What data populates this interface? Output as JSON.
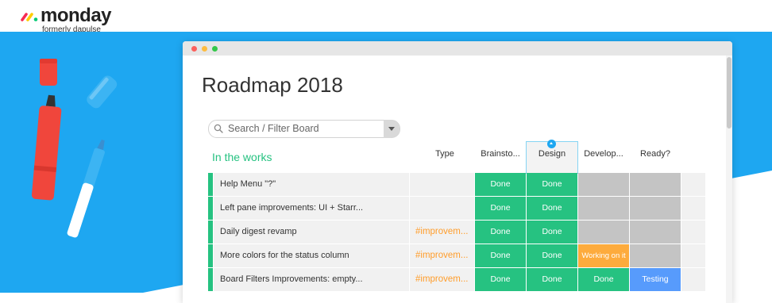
{
  "brand": {
    "name": "monday",
    "subtitle": "formerly dapulse"
  },
  "board": {
    "title": "Roadmap 2018",
    "search": {
      "placeholder": "Search / Filter Board",
      "value": ""
    },
    "group": {
      "title": "In the works",
      "color": "#26c281"
    },
    "columns": [
      "Type",
      "Brainsto...",
      "Design",
      "Develop...",
      "Ready?"
    ],
    "selected_column": "Design",
    "rows": [
      {
        "name": "Help Menu \"?\"",
        "type": "",
        "brainstorm": "Done",
        "design": "Done",
        "develop": "",
        "ready": ""
      },
      {
        "name": "Left pane improvements: UI + Starr...",
        "type": "",
        "brainstorm": "Done",
        "design": "Done",
        "develop": "",
        "ready": ""
      },
      {
        "name": "Daily digest revamp",
        "type": "#improvem...",
        "brainstorm": "Done",
        "design": "Done",
        "develop": "",
        "ready": ""
      },
      {
        "name": "More colors for the status column",
        "type": "#improvem...",
        "brainstorm": "Done",
        "design": "Done",
        "develop": "Working on it",
        "ready": ""
      },
      {
        "name": "Board Filters Improvements: empty...",
        "type": "#improvem...",
        "brainstorm": "Done",
        "design": "Done",
        "develop": "Done",
        "ready": "Testing"
      }
    ]
  },
  "colors": {
    "done": "#26c281",
    "working": "#fdab3d",
    "testing": "#579bfc",
    "empty": "#c4c4c4",
    "hashtag": "#ff9d2b",
    "background_blue": "#1ea7f1"
  }
}
